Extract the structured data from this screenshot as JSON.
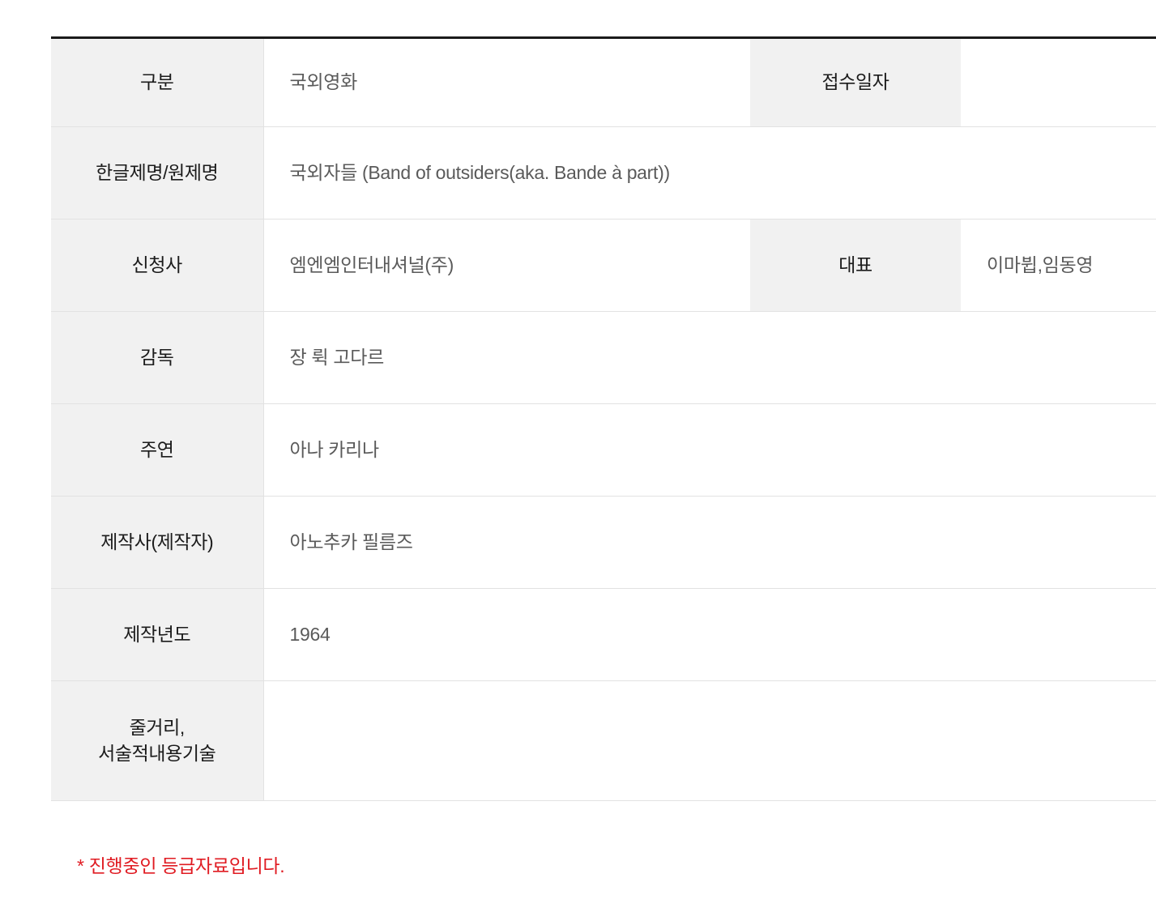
{
  "colors": {
    "label_bg": "#f1f1f1",
    "label_text": "#1b1b1b",
    "value_text": "#5a5a5a",
    "top_border": "#1b1b1b",
    "row_border": "#e2e2e2",
    "footnote_red": "#e01b22"
  },
  "detail_table": {
    "rows": [
      {
        "label": "구분",
        "value": "국외영화",
        "sub_label": "접수일자",
        "sub_value": ""
      },
      {
        "label": "한글제명/원제명",
        "value": "국외자들  (Band of outsiders(aka. Bande à part))",
        "sub_label": "",
        "sub_value": ""
      },
      {
        "label": "신청사",
        "value": "엠엔엠인터내셔널(주)",
        "sub_label": "대표",
        "sub_value": "이마뷥,임동영"
      },
      {
        "label": "감독",
        "value": "장 뤽 고다르",
        "sub_label": "",
        "sub_value": ""
      },
      {
        "label": "주연",
        "value": "아나 카리나",
        "sub_label": "",
        "sub_value": ""
      },
      {
        "label": "제작사(제작자)",
        "value": "아노추카 필름즈",
        "sub_label": "",
        "sub_value": ""
      },
      {
        "label": "제작년도",
        "value": "1964",
        "sub_label": "",
        "sub_value": ""
      },
      {
        "label_line_1": "줄거리,",
        "label_line_2": "서술적내용기술",
        "value": "",
        "sub_label": "",
        "sub_value": ""
      }
    ]
  },
  "footnote": {
    "text": "* 진행중인 등급자료입니다."
  }
}
